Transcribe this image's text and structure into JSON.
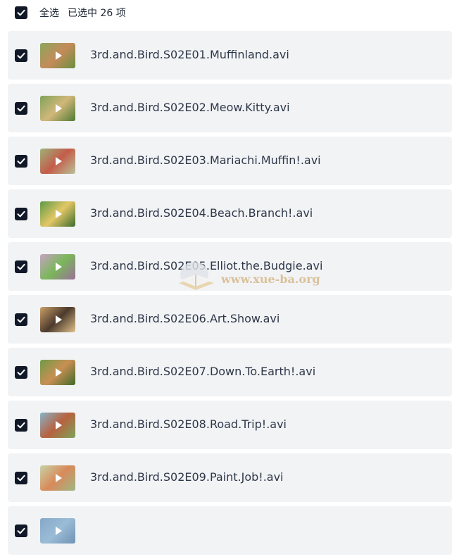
{
  "header": {
    "select_all_label": "全选",
    "selected_count_label": "已选中 26 项"
  },
  "files": [
    {
      "name": "3rd.and.Bird.S02E01.Muffinland.avi",
      "checked": true,
      "thumb_colors": [
        "#8aa65c",
        "#c58b5a",
        "#6a8f3e"
      ]
    },
    {
      "name": "3rd.and.Bird.S02E02.Meow.Kitty.avi",
      "checked": true,
      "thumb_colors": [
        "#7fa35a",
        "#d2b77a",
        "#4e7a35"
      ]
    },
    {
      "name": "3rd.and.Bird.S02E03.Mariachi.Muffin!.avi",
      "checked": true,
      "thumb_colors": [
        "#9db27a",
        "#c45c4a",
        "#b9c39a"
      ]
    },
    {
      "name": "3rd.and.Bird.S02E04.Beach.Branch!.avi",
      "checked": true,
      "thumb_colors": [
        "#5d9a46",
        "#e4c766",
        "#3a6d2d"
      ]
    },
    {
      "name": "3rd.and.Bird.S02E05.Elliot.the.Budgie.avi",
      "checked": true,
      "thumb_colors": [
        "#c7a2c4",
        "#7ab75a",
        "#9a6f9a"
      ]
    },
    {
      "name": "3rd.and.Bird.S02E06.Art.Show.avi",
      "checked": true,
      "thumb_colors": [
        "#c9a067",
        "#4d3a2c",
        "#e1c28d"
      ]
    },
    {
      "name": "3rd.and.Bird.S02E07.Down.To.Earth!.avi",
      "checked": true,
      "thumb_colors": [
        "#6f9b48",
        "#c98f53",
        "#3e6a2a"
      ]
    },
    {
      "name": "3rd.and.Bird.S02E08.Road.Trip!.avi",
      "checked": true,
      "thumb_colors": [
        "#88b3c9",
        "#b7613f",
        "#7da55a"
      ]
    },
    {
      "name": "3rd.and.Bird.S02E09.Paint.Job!.avi",
      "checked": true,
      "thumb_colors": [
        "#c7d3a7",
        "#d88a5a",
        "#9fb685"
      ]
    },
    {
      "name": "",
      "checked": true,
      "thumb_colors": [
        "#86a8c8",
        "#9bbcd6",
        "#6f93b4"
      ]
    }
  ],
  "watermark": {
    "text": "www.xue-ba.org"
  },
  "colors": {
    "checkbox": "#111827",
    "row_bg": "#f2f3f5",
    "text": "#2d3748"
  }
}
